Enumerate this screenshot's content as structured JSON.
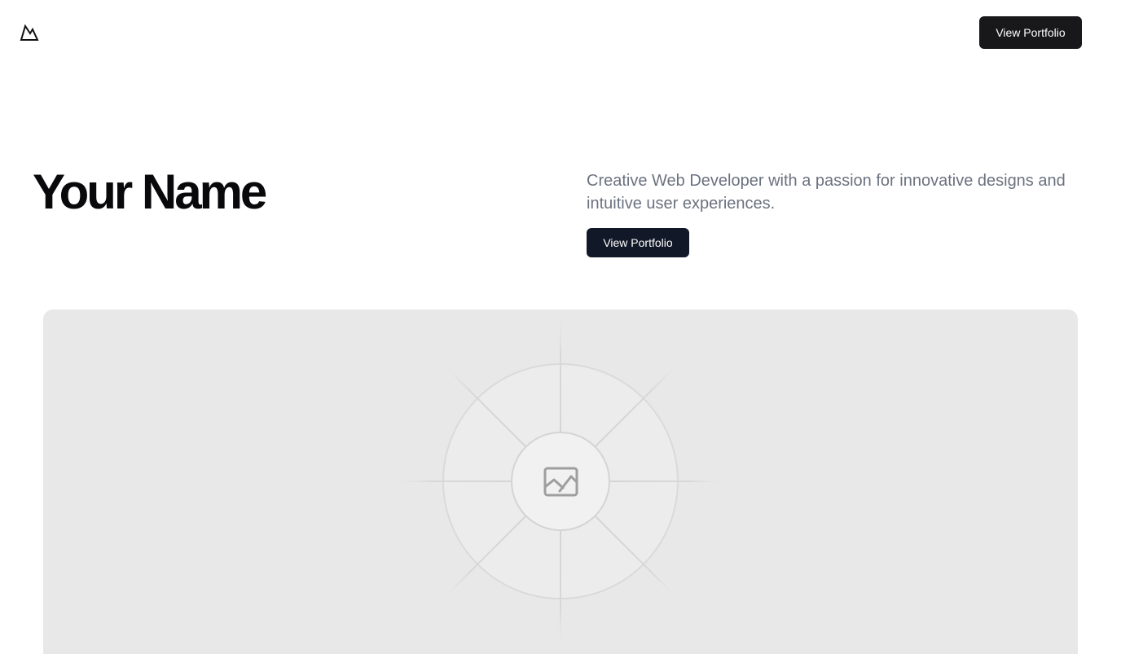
{
  "header": {
    "logo_icon": "mountain-icon",
    "cta_label": "View Portfolio"
  },
  "hero": {
    "title": "Your Name",
    "description": "Creative Web Developer with a passion for innovative designs and intuitive user experiences.",
    "cta_label": "View Portfolio"
  },
  "media": {
    "placeholder_icon": "image-icon"
  },
  "colors": {
    "button_dark": "#18181b",
    "button_navy": "#111827",
    "title": "#09090b",
    "description": "#6b7280",
    "placeholder_bg": "#e8e8e8"
  }
}
